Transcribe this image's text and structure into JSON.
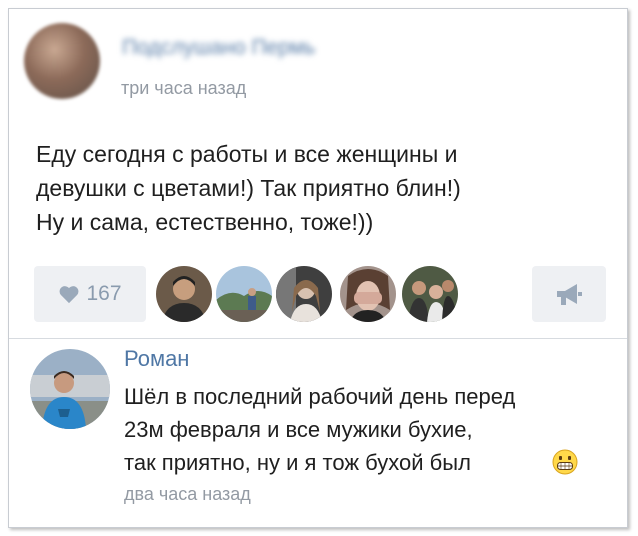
{
  "post": {
    "group_name": "Подслушано Пермь",
    "time": "три часа назад",
    "text": "Еду сегодня с работы и все женщины и\nдевушки с цветами!) Так приятно блин!)\nНу и сама, естественно, тоже!))",
    "likes": "167",
    "like_icon": "heart-icon",
    "share_icon": "megaphone-icon"
  },
  "comment": {
    "author": "Роман",
    "text": "Шёл в последний рабочий день перед\n23м февраля и все мужики бухие,\nтак приятно, ну и я тож бухой был",
    "emoji": "grinning-face-icon",
    "time": "два часа назад"
  },
  "colors": {
    "link": "#4f77a5",
    "muted": "#939aa3",
    "button_bg": "#eef0f3",
    "text": "#1f1f1f"
  }
}
